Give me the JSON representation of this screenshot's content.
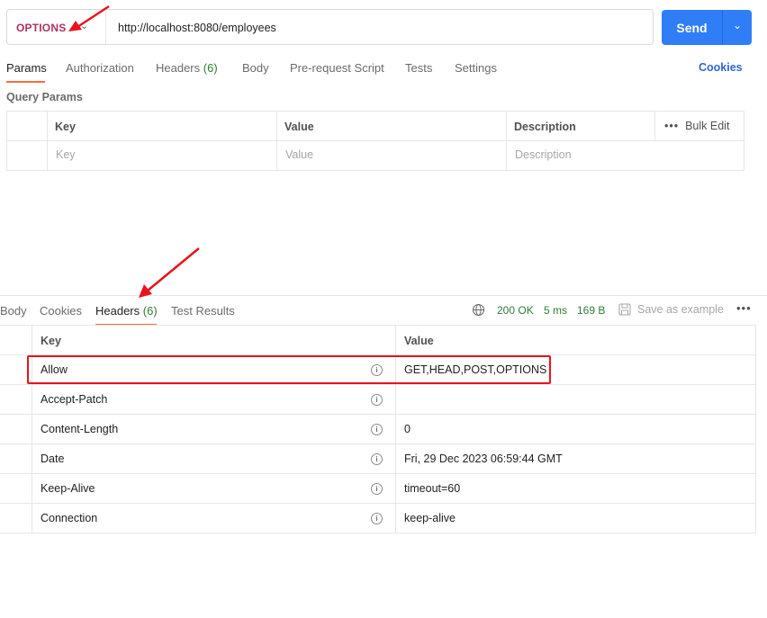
{
  "request": {
    "method": "OPTIONS",
    "url": "http://localhost:8080/employees",
    "send_label": "Send"
  },
  "request_tabs": [
    {
      "label": "Params"
    },
    {
      "label": "Authorization"
    },
    {
      "label": "Headers",
      "count": "(6)"
    },
    {
      "label": "Body"
    },
    {
      "label": "Pre-request Script"
    },
    {
      "label": "Tests"
    },
    {
      "label": "Settings"
    }
  ],
  "cookies_link": "Cookies",
  "query_params": {
    "title": "Query Params",
    "columns": [
      "Key",
      "Value",
      "Description"
    ],
    "placeholders": [
      "Key",
      "Value",
      "Description"
    ],
    "bulk_edit": "Bulk Edit"
  },
  "response": {
    "tabs": [
      {
        "label": "Body"
      },
      {
        "label": "Cookies"
      },
      {
        "label": "Headers",
        "count": "(6)"
      },
      {
        "label": "Test Results"
      }
    ],
    "status": "200 OK",
    "time": "5 ms",
    "size": "169 B",
    "save_example": "Save as example",
    "columns": [
      "Key",
      "Value"
    ],
    "headers": [
      {
        "key": "Allow",
        "value": "GET,HEAD,POST,OPTIONS"
      },
      {
        "key": "Accept-Patch",
        "value": ""
      },
      {
        "key": "Content-Length",
        "value": "0"
      },
      {
        "key": "Date",
        "value": "Fri, 29 Dec 2023 06:59:44 GMT"
      },
      {
        "key": "Keep-Alive",
        "value": "timeout=60"
      },
      {
        "key": "Connection",
        "value": "keep-alive"
      }
    ]
  },
  "colors": {
    "method": "#b03062",
    "send": "#2f7ef7",
    "active_tab_underline": "#ff6c37",
    "status": "#2e7d32",
    "annotation": "#e8141b"
  },
  "icons": [
    "chevron-down-icon",
    "globe-icon",
    "save-icon",
    "more-icon",
    "info-icon",
    "arrow-annotation"
  ]
}
